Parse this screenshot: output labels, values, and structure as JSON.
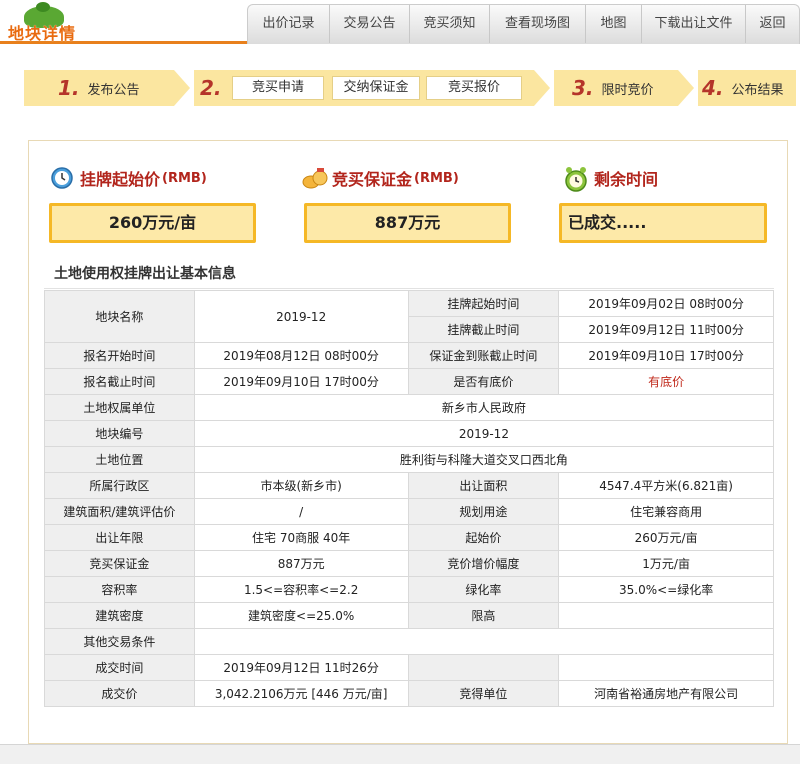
{
  "header": {
    "logo_text": "地块详情",
    "nav": [
      "出价记录",
      "交易公告",
      "竞买须知",
      "查看现场图",
      "地图",
      "下载出让文件",
      "返回"
    ]
  },
  "steps": {
    "s1": {
      "num": "1.",
      "label": "发布公告"
    },
    "s2": {
      "num": "2.",
      "subs": [
        "竞买申请",
        "交纳保证金",
        "竞买报价"
      ]
    },
    "s3": {
      "num": "3.",
      "label": "限时竞价"
    },
    "s4": {
      "num": "4.",
      "label": "公布结果"
    }
  },
  "summary": {
    "start_price_label": "挂牌起始价",
    "start_price_unit": "(RMB)",
    "start_price_value": "260万元/亩",
    "deposit_label": "竞买保证金",
    "deposit_unit": "(RMB)",
    "deposit_value": "887万元",
    "remain_label": "剩余时间",
    "remain_value": "已成交....."
  },
  "section_title": "土地使用权挂牌出让基本信息",
  "table": {
    "r1": {
      "l1": "地块名称",
      "v1": "2019-12",
      "l2a": "挂牌起始时间",
      "v2a": "2019年09月02日 08时00分",
      "l2b": "挂牌截止时间",
      "v2b": "2019年09月12日 11时00分"
    },
    "r2": {
      "l1": "报名开始时间",
      "v1": "2019年08月12日 08时00分",
      "l2": "保证金到账截止时间",
      "v2": "2019年09月10日 17时00分"
    },
    "r3": {
      "l1": "报名截止时间",
      "v1": "2019年09月10日 17时00分",
      "l2": "是否有底价",
      "v2": "有底价"
    },
    "r4": {
      "l1": "土地权属单位",
      "v1": "新乡市人民政府"
    },
    "r5": {
      "l1": "地块编号",
      "v1": "2019-12"
    },
    "r6": {
      "l1": "土地位置",
      "v1": "胜利街与科隆大道交叉口西北角"
    },
    "r7": {
      "l1": "所属行政区",
      "v1": "市本级(新乡市)",
      "l2": "出让面积",
      "v2": "4547.4平方米(6.821亩)"
    },
    "r8": {
      "l1": "建筑面积/建筑评估价",
      "v1": "/",
      "l2": "规划用途",
      "v2": "住宅兼容商用"
    },
    "r9": {
      "l1": "出让年限",
      "v1": "住宅 70商服 40年",
      "l2": "起始价",
      "v2": "260万元/亩"
    },
    "r10": {
      "l1": "竞买保证金",
      "v1": "887万元",
      "l2": "竞价增价幅度",
      "v2": "1万元/亩"
    },
    "r11": {
      "l1": "容积率",
      "v1": "1.5<=容积率<=2.2",
      "l2": "绿化率",
      "v2": "35.0%<=绿化率"
    },
    "r12": {
      "l1": "建筑密度",
      "v1": "建筑密度<=25.0%",
      "l2": "限高",
      "v2": ""
    },
    "r13": {
      "l1": "其他交易条件",
      "v1": ""
    },
    "r14": {
      "l1": "成交时间",
      "v1": "2019年09月12日 11时26分",
      "l2": "",
      "v2": ""
    },
    "r15": {
      "l1": "成交价",
      "v1": "3,042.2106万元 [446 万元/亩]",
      "l2": "竞得单位",
      "v2": "河南省裕通房地产有限公司"
    }
  },
  "colors": {
    "accent": "#e8801c",
    "step_bg": "#fbe6a0",
    "value_box": "#fde9a8",
    "value_border": "#f5b826",
    "title_red": "#b2251c"
  }
}
